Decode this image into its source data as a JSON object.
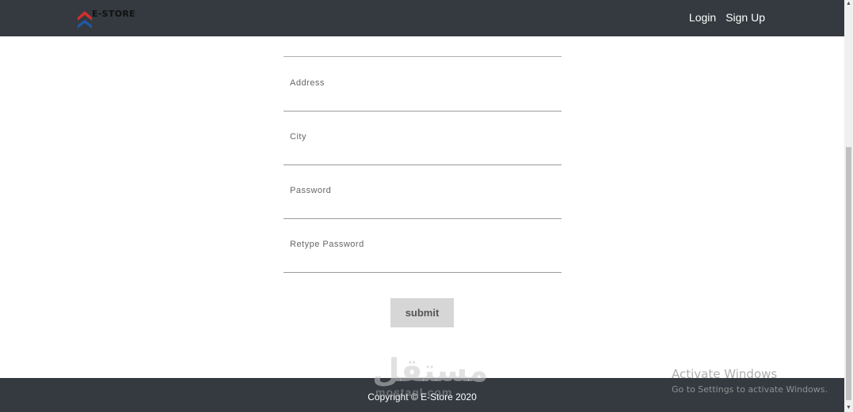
{
  "navbar": {
    "logo_text": "E-STORE",
    "login_label": "Login",
    "signup_label": "Sign Up"
  },
  "form": {
    "fields": [
      {
        "label": "Address",
        "value": ""
      },
      {
        "label": "City",
        "value": ""
      },
      {
        "label": "Password",
        "value": ""
      },
      {
        "label": "Retype Password",
        "value": ""
      }
    ],
    "submit_label": "submit"
  },
  "footer": {
    "copyright": "Copyright © E-Store 2020"
  },
  "watermark": {
    "arabic": "مستقل",
    "latin": "mostaql.com"
  },
  "activate_windows": {
    "title": "Activate Windows",
    "subtitle": "Go to Settings to activate Windows."
  },
  "icons": {
    "logo": "store-logo-icon",
    "scroll_up": "scroll-up-arrow-icon",
    "scroll_down": "scroll-down-arrow-icon"
  },
  "colors": {
    "navbar": "#343a40",
    "footer": "#343a40",
    "submit_bg": "#d6d6d6",
    "logo_red": "#d32f2f",
    "logo_blue": "#1e5aa8"
  }
}
